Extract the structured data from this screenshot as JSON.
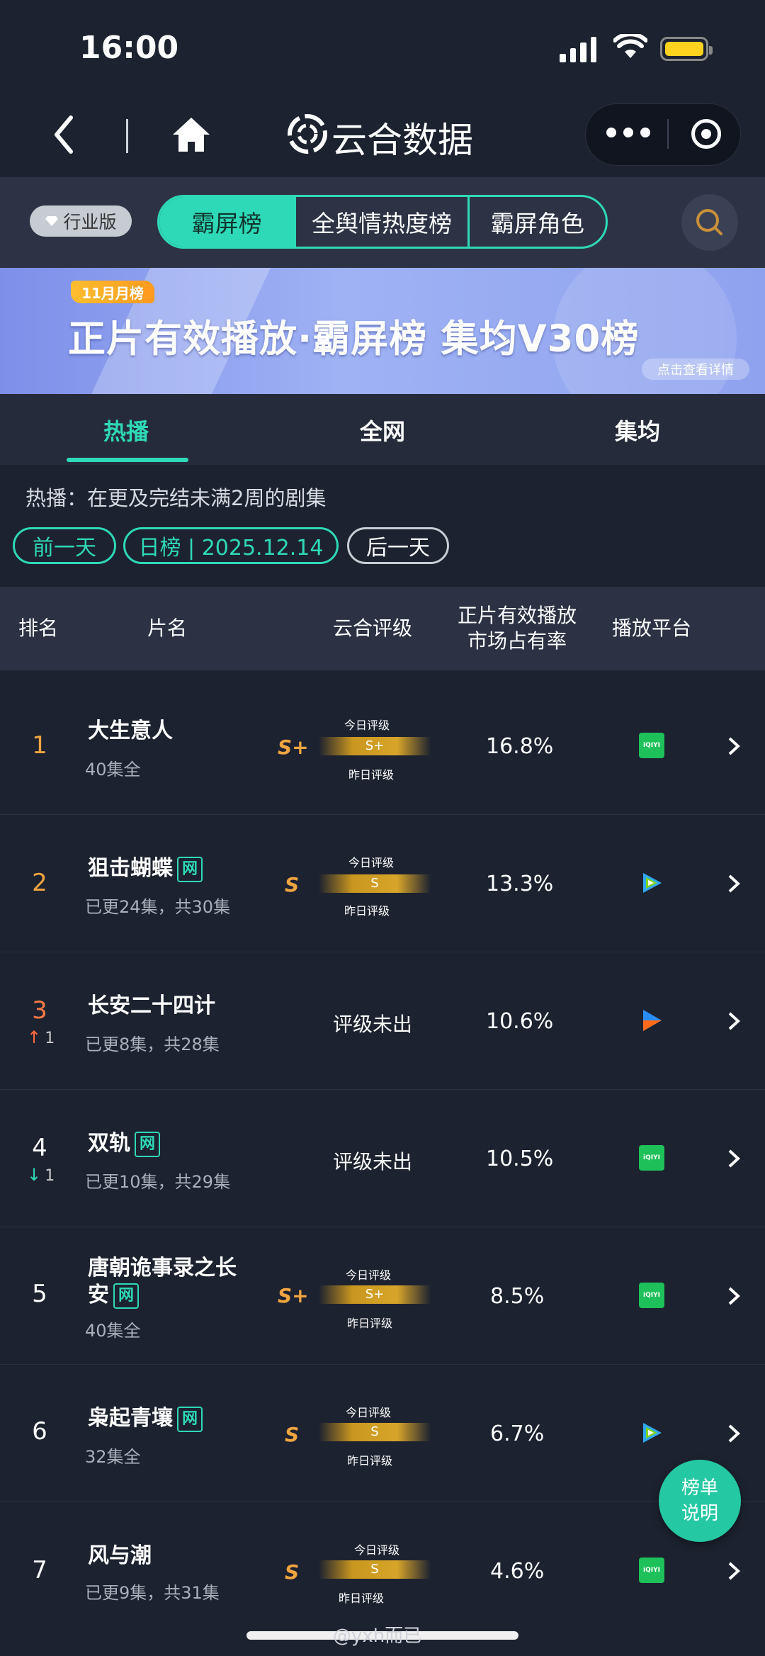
{
  "status": {
    "time": "16:00"
  },
  "nav": {
    "title": "云合数据"
  },
  "categories": {
    "badge": "行业版",
    "segments": [
      "霸屏榜",
      "全舆情热度榜",
      "霸屏角色"
    ]
  },
  "banner": {
    "month_badge": "11月月榜",
    "title": "正片有效播放·霸屏榜 集均V30榜",
    "detail_link": "点击查看详情"
  },
  "tabs": [
    "热播",
    "全网",
    "集均"
  ],
  "description": "热播：在更及完结未满2周的剧集",
  "date_nav": {
    "prev": "前一天",
    "current": "日榜 | 2025.12.14",
    "next": "后一天"
  },
  "table": {
    "headers": {
      "rank": "排名",
      "title": "片名",
      "rating": "云合评级",
      "share_line1": "正片有效播放",
      "share_line2": "市场占有率",
      "platform": "播放平台"
    },
    "rating_today_label": "今日评级",
    "rating_yesterday_label": "昨日评级",
    "rows": [
      {
        "rank": "1",
        "title": "大生意人",
        "net": "",
        "sub": "40集全",
        "grade": "S+",
        "share": "16.8%",
        "platform": "iqiyi"
      },
      {
        "rank": "2",
        "title": "狙击蝴蝶",
        "net": "网",
        "sub": "已更24集，共30集",
        "grade": "S",
        "share": "13.3%",
        "platform": "tencent"
      },
      {
        "rank": "3",
        "trend": "↑",
        "trend_num": "1",
        "title": "长安二十四计",
        "net": "",
        "sub": "已更8集，共28集",
        "grade_text": "评级未出",
        "share": "10.6%",
        "platform": "youku"
      },
      {
        "rank": "4",
        "trend": "↓",
        "trend_num": "1",
        "title": "双轨",
        "net": "网",
        "sub": "已更10集，共29集",
        "grade_text": "评级未出",
        "share": "10.5%",
        "platform": "iqiyi"
      },
      {
        "rank": "5",
        "title_line1": "唐朝诡事录之长",
        "title_line2": "安",
        "net": "网",
        "sub": "40集全",
        "grade": "S+",
        "share": "8.5%",
        "platform": "iqiyi"
      },
      {
        "rank": "6",
        "title": "枭起青壤",
        "net": "网",
        "sub": "32集全",
        "grade": "S",
        "share": "6.7%",
        "platform": "tencent"
      },
      {
        "rank": "7",
        "title": "风与潮",
        "net": "",
        "sub": "已更9集，共31集",
        "grade": "S",
        "share": "4.6%",
        "platform": "iqiyi"
      }
    ]
  },
  "fab": {
    "line1": "榜单",
    "line2": "说明"
  },
  "watermark": "@yxh而已",
  "iqiyi_label": "iQIYI",
  "colors": {
    "accent": "#2ed9b7",
    "gold": "#f0a540",
    "background": "#1d2230"
  }
}
